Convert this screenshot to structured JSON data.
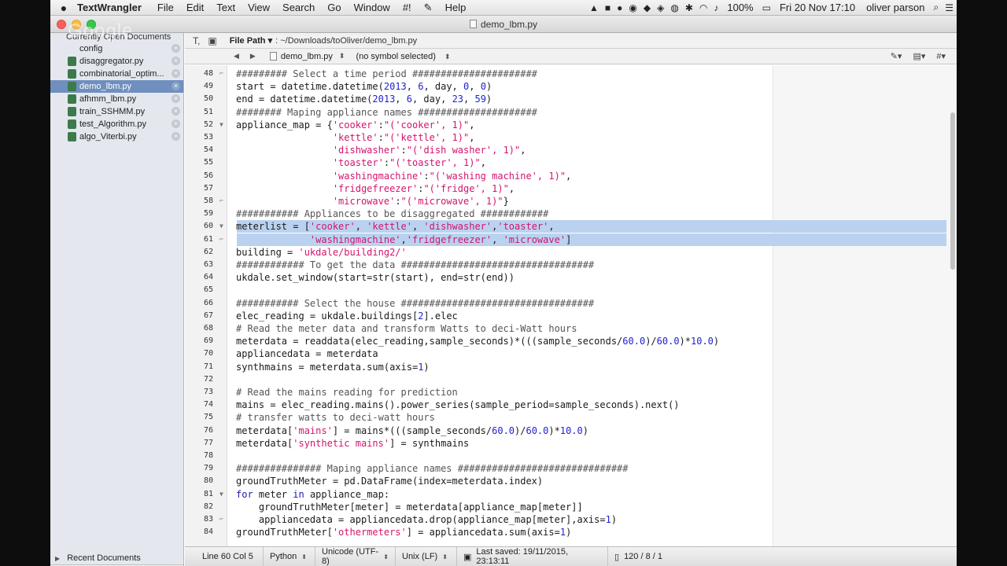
{
  "menubar": {
    "app_name": "TextWrangler",
    "menus": [
      "File",
      "Edit",
      "Text",
      "View",
      "Search",
      "Go",
      "Window",
      "#!",
      "Help"
    ],
    "script_icon": "script-icon",
    "battery": "100%",
    "datetime": "Fri 20 Nov  17:10",
    "user": "oliver parson"
  },
  "window": {
    "title": "demo_lbm.py",
    "watermark": "Google"
  },
  "sidebar": {
    "header": "Currently Open Documents",
    "items": [
      {
        "label": "config",
        "icon": "plain"
      },
      {
        "label": "disaggregator.py",
        "icon": "py"
      },
      {
        "label": "combinatorial_optim...",
        "icon": "py"
      },
      {
        "label": "demo_lbm.py",
        "icon": "py",
        "selected": true
      },
      {
        "label": "afhmm_lbm.py",
        "icon": "py"
      },
      {
        "label": "train_SSHMM.py",
        "icon": "py"
      },
      {
        "label": "test_Algorithm.py",
        "icon": "py"
      },
      {
        "label": "algo_Viterbi.py",
        "icon": "py"
      }
    ],
    "recent": "Recent Documents"
  },
  "toolbar": {
    "file_path_label": "File Path ▾",
    "file_path": ": ~/Downloads/toOliver/demo_lbm.py",
    "file_selector": "demo_lbm.py",
    "symbol_selector": "(no symbol selected)"
  },
  "editor": {
    "highlight_lines": [
      60,
      61
    ],
    "fold_lines": [
      52,
      60,
      81
    ],
    "fold_end_lines": [
      48,
      58,
      61,
      83
    ],
    "lines": [
      {
        "n": "48",
        "t": "######### Select a time period ######################"
      },
      {
        "n": "49",
        "t": "start = datetime.datetime(2013, 6, day, 0, 0)"
      },
      {
        "n": "50",
        "t": "end = datetime.datetime(2013, 6, day, 23, 59)"
      },
      {
        "n": "51",
        "t": "######## Maping appliance names #####################"
      },
      {
        "n": "52",
        "t": "appliance_map = {'cooker':\"('cooker', 1)\","
      },
      {
        "n": "53",
        "t": "                 'kettle':\"('kettle', 1)\","
      },
      {
        "n": "54",
        "t": "                 'dishwasher':\"('dish washer', 1)\","
      },
      {
        "n": "55",
        "t": "                 'toaster':\"('toaster', 1)\","
      },
      {
        "n": "56",
        "t": "                 'washingmachine':\"('washing machine', 1)\","
      },
      {
        "n": "57",
        "t": "                 'fridgefreezer':\"('fridge', 1)\","
      },
      {
        "n": "58",
        "t": "                 'microwave':\"('microwave', 1)\"}"
      },
      {
        "n": "59",
        "t": "########### Appliances to be disaggregated ############"
      },
      {
        "n": "60",
        "t": "meterlist = ['cooker', 'kettle', 'dishwasher','toaster',"
      },
      {
        "n": "61",
        "t": "             'washingmachine','fridgefreezer', 'microwave']"
      },
      {
        "n": "62",
        "t": "building = 'ukdale/building2/'"
      },
      {
        "n": "63",
        "t": "############ To get the data ##################################"
      },
      {
        "n": "64",
        "t": "ukdale.set_window(start=str(start), end=str(end))"
      },
      {
        "n": "65",
        "t": ""
      },
      {
        "n": "66",
        "t": "########### Select the house ##################################"
      },
      {
        "n": "67",
        "t": "elec_reading = ukdale.buildings[2].elec"
      },
      {
        "n": "68",
        "t": "# Read the meter data and transform Watts to deci-Watt hours"
      },
      {
        "n": "69",
        "t": "meterdata = readdata(elec_reading,sample_seconds)*(((sample_seconds/60.0)/60.0)*10.0)"
      },
      {
        "n": "70",
        "t": "appliancedata = meterdata"
      },
      {
        "n": "71",
        "t": "synthmains = meterdata.sum(axis=1)"
      },
      {
        "n": "72",
        "t": ""
      },
      {
        "n": "73",
        "t": "# Read the mains reading for prediction"
      },
      {
        "n": "74",
        "t": "mains = elec_reading.mains().power_series(sample_period=sample_seconds).next()"
      },
      {
        "n": "75",
        "t": "# transfer watts to deci-watt hours"
      },
      {
        "n": "76",
        "t": "meterdata['mains'] = mains*(((sample_seconds/60.0)/60.0)*10.0)"
      },
      {
        "n": "77",
        "t": "meterdata['synthetic mains'] = synthmains"
      },
      {
        "n": "78",
        "t": ""
      },
      {
        "n": "79",
        "t": "############### Maping appliance names ##############################"
      },
      {
        "n": "80",
        "t": "groundTruthMeter = pd.DataFrame(index=meterdata.index)"
      },
      {
        "n": "81",
        "t": "for meter in appliance_map:"
      },
      {
        "n": "82",
        "t": "    groundTruthMeter[meter] = meterdata[appliance_map[meter]]"
      },
      {
        "n": "83",
        "t": "    appliancedata = appliancedata.drop(appliance_map[meter],axis=1)"
      },
      {
        "n": "84",
        "t": "groundTruthMeter['othermeters'] = appliancedata.sum(axis=1)"
      }
    ]
  },
  "statusbar": {
    "position": "Line 60 Col 5",
    "language": "Python",
    "encoding": "Unicode (UTF-8)",
    "line_endings": "Unix (LF)",
    "last_saved": "Last saved: 19/11/2015, 23:13:11",
    "counts": "120 / 8 / 1"
  },
  "colors": {
    "string": "#d2146e",
    "keyword": "#1a1ab0",
    "selection": "#bad2ef",
    "sidebar_selection": "#6f8fbf"
  }
}
